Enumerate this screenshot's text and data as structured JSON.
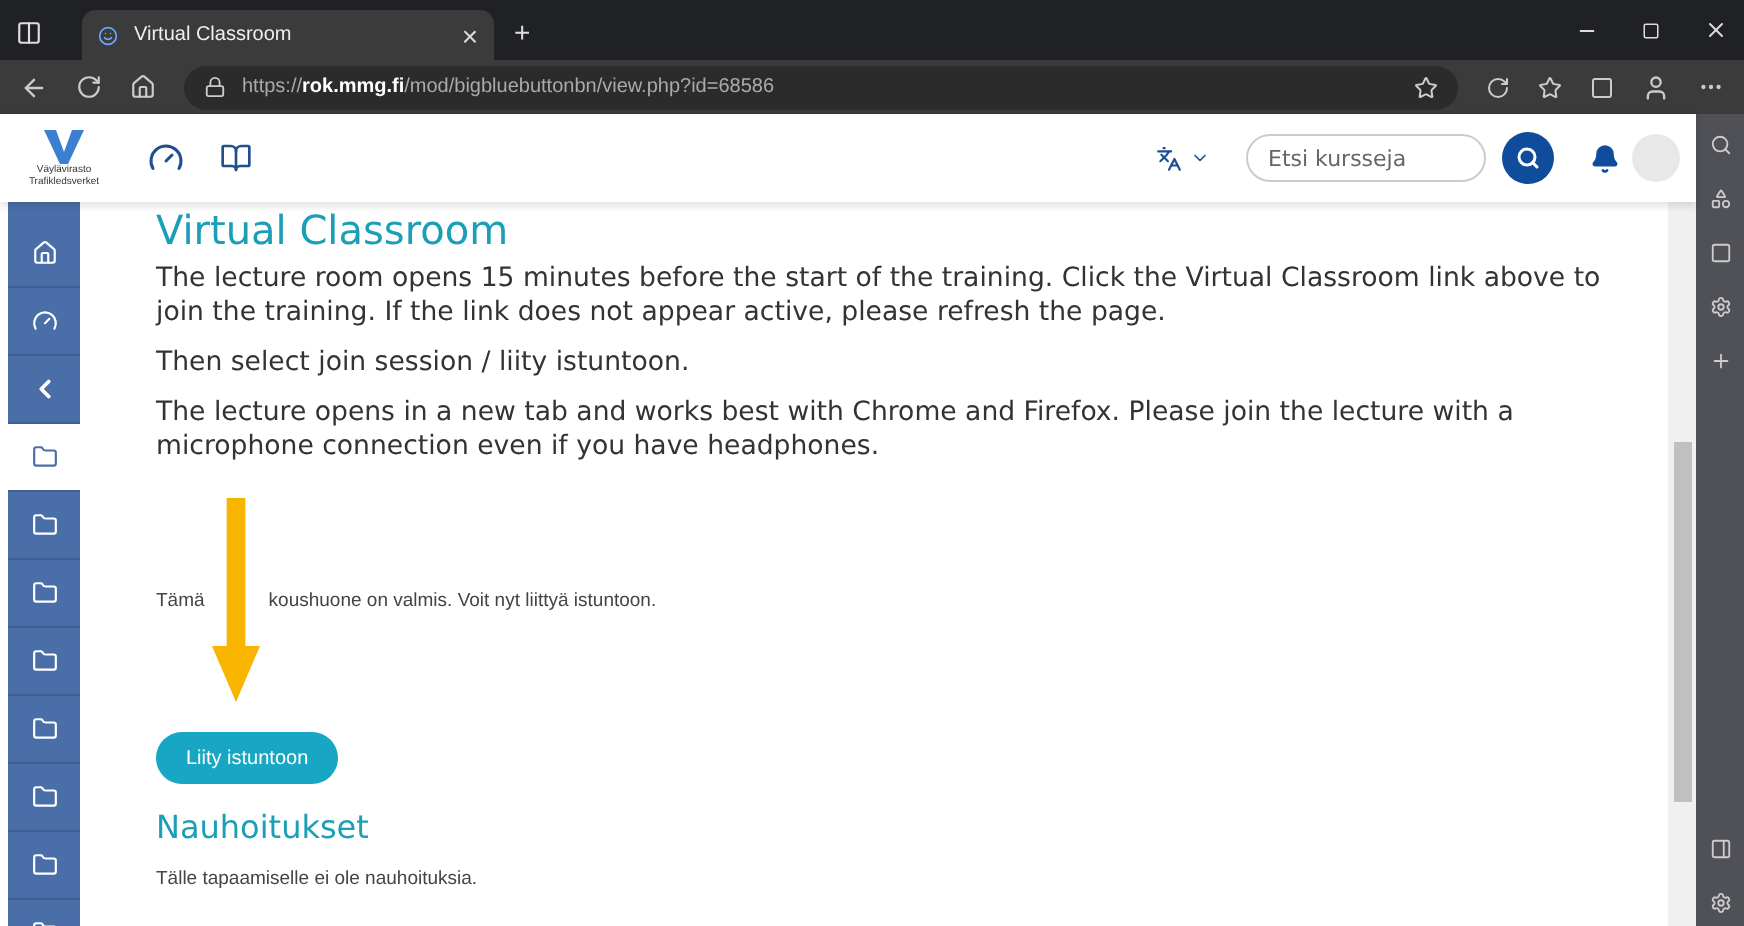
{
  "browser": {
    "tab": {
      "title": "Virtual Classroom",
      "close": "×",
      "new_tab": "+"
    },
    "address": {
      "scheme": "https://",
      "host": "rok.mmg.fi",
      "path": "/mod/bigbluebuttonbn/view.php?id=68586"
    }
  },
  "header": {
    "logo_lines": [
      "Väylävirasto",
      "Trafikledsverket"
    ],
    "search": {
      "placeholder": "Etsi kursseja"
    }
  },
  "sidebar": {
    "items": [
      {
        "kind": "home",
        "selected": false
      },
      {
        "kind": "dashboard",
        "selected": false
      },
      {
        "kind": "collapse",
        "selected": false
      },
      {
        "kind": "folder",
        "selected": true
      },
      {
        "kind": "folder",
        "selected": false
      },
      {
        "kind": "folder",
        "selected": false
      },
      {
        "kind": "folder",
        "selected": false
      },
      {
        "kind": "folder",
        "selected": false
      },
      {
        "kind": "folder",
        "selected": false
      },
      {
        "kind": "folder",
        "selected": false
      },
      {
        "kind": "folder",
        "selected": false
      }
    ]
  },
  "content": {
    "heading": "Virtual Classroom",
    "paragraphs": [
      "The lecture room opens 15 minutes before the start of the training. Click the Virtual Classroom link above to join the training. If the link does not appear active, please refresh the page.",
      "Then select join session / liity istuntoon.",
      "The lecture opens in a new tab and works best with Chrome and Firefox. Please join the lecture with a microphone connection even if you have headphones."
    ],
    "status_parts": [
      "Tämä",
      "koushuone on valmis. Voit nyt liittyä istuntoon."
    ],
    "join_button": "Liity istuntoon",
    "recordings_heading": "Nauhoitukset",
    "recordings_note": "Tälle tapaamiselle ei ole nauhoituksia."
  }
}
